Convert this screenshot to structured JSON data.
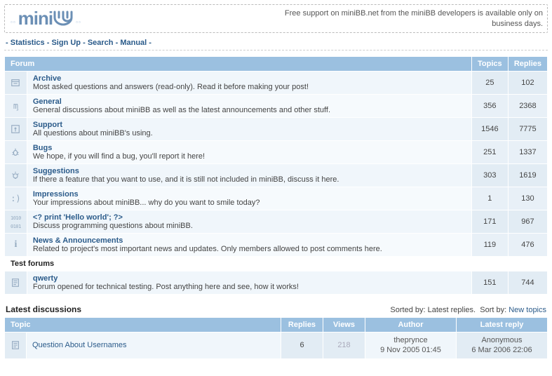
{
  "header": {
    "logo_text": "miniBB",
    "tagline": "Free support on miniBB.net from the miniBB developers is available only on business days."
  },
  "nav": {
    "items": [
      "Statistics",
      "Sign Up",
      "Search",
      "Manual"
    ]
  },
  "forum_table": {
    "headers": {
      "forum": "Forum",
      "topics": "Topics",
      "replies": "Replies"
    }
  },
  "forums": [
    {
      "icon": "archive-icon",
      "title": "Archive",
      "desc": "Most asked questions and answers (read-only). Read it before making your post!",
      "topics": "25",
      "replies": "102"
    },
    {
      "icon": "general-icon",
      "title": "General",
      "desc": "General discussions about miniBB as well as the latest announcements and other stuff.",
      "topics": "356",
      "replies": "2368"
    },
    {
      "icon": "support-icon",
      "title": "Support",
      "desc": "All questions about miniBB's using.",
      "topics": "1546",
      "replies": "7775"
    },
    {
      "icon": "bug-icon",
      "title": "Bugs",
      "desc": "We hope, if you will find a bug, you'll report it here!",
      "topics": "251",
      "replies": "1337"
    },
    {
      "icon": "idea-icon",
      "title": "Suggestions",
      "desc": "If there a feature that you want to use, and it is still not included in miniBB, discuss it here.",
      "topics": "303",
      "replies": "1619"
    },
    {
      "icon": "smile-icon",
      "title": "Impressions",
      "desc": "Your impressions about miniBB... why do you want to smile today?",
      "topics": "1",
      "replies": "130"
    },
    {
      "icon": "code-icon",
      "title": "<? print 'Hello world'; ?>",
      "desc": "Discuss programming questions about miniBB.",
      "topics": "171",
      "replies": "967"
    },
    {
      "icon": "info-icon",
      "title": "News & Announcements",
      "desc": "Related to project's most important news and updates. Only members allowed to post comments here.",
      "topics": "119",
      "replies": "476"
    }
  ],
  "test_section": {
    "label": "Test forums"
  },
  "test_forums": [
    {
      "icon": "page-icon",
      "title": "qwerty",
      "desc": "Forum opened for technical testing. Post anything here and see, how it works!",
      "topics": "151",
      "replies": "744"
    }
  ],
  "latest": {
    "heading": "Latest discussions",
    "sorted_by_label": "Sorted by: ",
    "sorted_by_value": "Latest replies.",
    "sort_link_label": "Sort by: ",
    "sort_link_value": "New topics",
    "headers": {
      "topic": "Topic",
      "replies": "Replies",
      "views": "Views",
      "author": "Author",
      "latest": "Latest reply"
    }
  },
  "topics": [
    {
      "title": "Question About Usernames",
      "replies": "6",
      "views": "218",
      "author": "theprynce",
      "author_date": "9 Nov 2005 01:45",
      "reply": "Anonymous",
      "reply_date": "6 Mar 2006 22:06"
    }
  ]
}
